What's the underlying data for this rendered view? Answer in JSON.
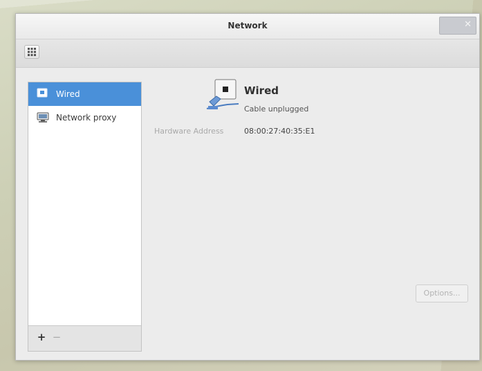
{
  "window": {
    "title": "Network",
    "close_symbol": "✕"
  },
  "toolbar": {
    "grid_icon": "app-grid-icon"
  },
  "sidebar": {
    "items": [
      {
        "label": "Wired",
        "icon": "ethernet-icon",
        "selected": true
      },
      {
        "label": "Network proxy",
        "icon": "network-proxy-icon",
        "selected": false
      }
    ],
    "add_symbol": "+",
    "remove_symbol": "−"
  },
  "detail": {
    "title": "Wired",
    "status": "Cable unplugged",
    "hardware_address_label": "Hardware Address",
    "hardware_address_value": "08:00:27:40:35:E1",
    "icon": "wired-connection-icon"
  },
  "options_button": {
    "label": "Options..."
  },
  "colors": {
    "selection": "#4a90d9",
    "window_bg": "#ececec"
  }
}
